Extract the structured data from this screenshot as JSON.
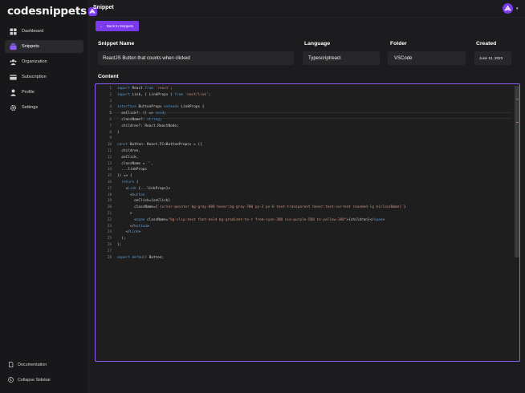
{
  "app": {
    "logo_text": "codesnippets",
    "page_title": "Snippet"
  },
  "sidebar": {
    "items": [
      {
        "label": "Dashboard",
        "icon": "dashboard-icon"
      },
      {
        "label": "Snippets",
        "icon": "snippets-icon",
        "active": true
      },
      {
        "label": "Organization",
        "icon": "organization-icon"
      },
      {
        "label": "Subscription",
        "icon": "subscription-icon"
      },
      {
        "label": "Profile",
        "icon": "profile-icon"
      },
      {
        "label": "Settings",
        "icon": "gear-icon"
      }
    ],
    "documentation_label": "Documentation",
    "collapse_label": "Collapse Sidebar"
  },
  "toolbar": {
    "back_label": "Back to Snippets"
  },
  "fields": {
    "name_label": "Snippet Name",
    "name_value": "ReactJS Button that counts when clicked",
    "language_label": "Language",
    "language_value": "Typescriptreact",
    "folder_label": "Folder",
    "folder_value": "VSCode",
    "created_label": "Created",
    "created_value": "June 12, 2023"
  },
  "content_label": "Content",
  "editor": {
    "current_line": 5,
    "lines": [
      "import React from 'react';",
      "import Link, { LinkProps } from 'next/link';",
      "",
      "interface ButtonProps extends LinkProps {",
      "  onClick?: () => void;",
      "  className?: string;",
      "  children?: React.ReactNode;",
      "}",
      "",
      "const Button: React.FC<ButtonProps> = ({",
      "  children,",
      "  onClick,",
      "  className = '',",
      "  ...linkProps",
      "}) => {",
      "  return (",
      "    <Link {...linkProps}>",
      "      <button",
      "        onClick={onClick}",
      "        className={`cursor-pointer bg-gray-800 hover:bg-gray-700 py-3 px-6 text-transparent hover:text-current rounded-lg ${className}`}",
      "      >",
      "        <span className=\"bg-clip-text font-bold bg-gradient-to-r from-cyan-300 via-purple-500 to-yellow-300\">{children}</span>",
      "      </button>",
      "    </Link>",
      "  );",
      "};",
      "",
      "export default Button;"
    ]
  },
  "colors": {
    "accent": "#7c3aed",
    "background": "#1c1c1e",
    "editor_bg": "#1e1e1e",
    "field_bg": "#27272a"
  }
}
